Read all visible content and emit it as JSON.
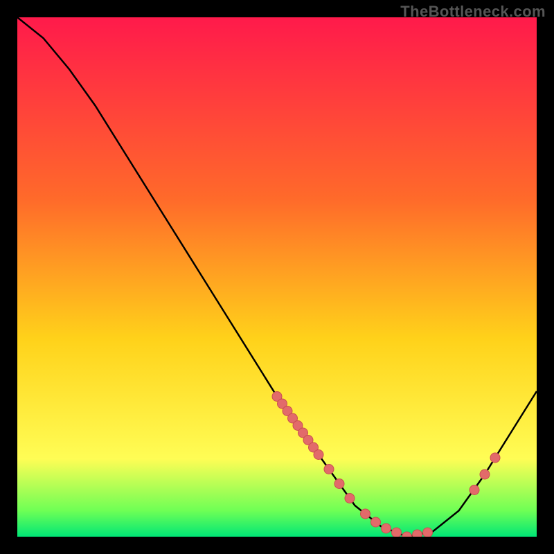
{
  "watermark": "TheBottleneck.com",
  "colors": {
    "bg": "#000000",
    "grad_top": "#ff1a4b",
    "grad_mid1": "#ff6a2a",
    "grad_mid2": "#ffd21a",
    "grad_low": "#fffd55",
    "grad_bottom1": "#6eff55",
    "grad_bottom2": "#00e676",
    "curve": "#000000",
    "marker_fill": "#e26a6a",
    "marker_stroke": "#c94f4f"
  },
  "chart_data": {
    "type": "line",
    "title": "",
    "xlabel": "",
    "ylabel": "",
    "xlim": [
      0,
      100
    ],
    "ylim": [
      0,
      100
    ],
    "curve": [
      {
        "x": 0,
        "y": 100
      },
      {
        "x": 5,
        "y": 96
      },
      {
        "x": 10,
        "y": 90
      },
      {
        "x": 15,
        "y": 83
      },
      {
        "x": 20,
        "y": 75
      },
      {
        "x": 25,
        "y": 67
      },
      {
        "x": 30,
        "y": 59
      },
      {
        "x": 35,
        "y": 51
      },
      {
        "x": 40,
        "y": 43
      },
      {
        "x": 45,
        "y": 35
      },
      {
        "x": 50,
        "y": 27
      },
      {
        "x": 55,
        "y": 20
      },
      {
        "x": 60,
        "y": 13
      },
      {
        "x": 65,
        "y": 6
      },
      {
        "x": 70,
        "y": 2
      },
      {
        "x": 75,
        "y": 0
      },
      {
        "x": 80,
        "y": 1
      },
      {
        "x": 85,
        "y": 5
      },
      {
        "x": 90,
        "y": 12
      },
      {
        "x": 95,
        "y": 20
      },
      {
        "x": 100,
        "y": 28
      }
    ],
    "markers": [
      {
        "x": 50,
        "y": 27
      },
      {
        "x": 51,
        "y": 25.6
      },
      {
        "x": 52,
        "y": 24.2
      },
      {
        "x": 53,
        "y": 22.8
      },
      {
        "x": 54,
        "y": 21.4
      },
      {
        "x": 55,
        "y": 20
      },
      {
        "x": 56,
        "y": 18.6
      },
      {
        "x": 57,
        "y": 17.2
      },
      {
        "x": 58,
        "y": 15.8
      },
      {
        "x": 60,
        "y": 13
      },
      {
        "x": 62,
        "y": 10.2
      },
      {
        "x": 64,
        "y": 7.4
      },
      {
        "x": 67,
        "y": 4.4
      },
      {
        "x": 69,
        "y": 2.8
      },
      {
        "x": 71,
        "y": 1.6
      },
      {
        "x": 73,
        "y": 0.8
      },
      {
        "x": 75,
        "y": 0
      },
      {
        "x": 77,
        "y": 0.4
      },
      {
        "x": 79,
        "y": 0.8
      },
      {
        "x": 88,
        "y": 9
      },
      {
        "x": 90,
        "y": 12
      },
      {
        "x": 92,
        "y": 15.2
      }
    ]
  }
}
